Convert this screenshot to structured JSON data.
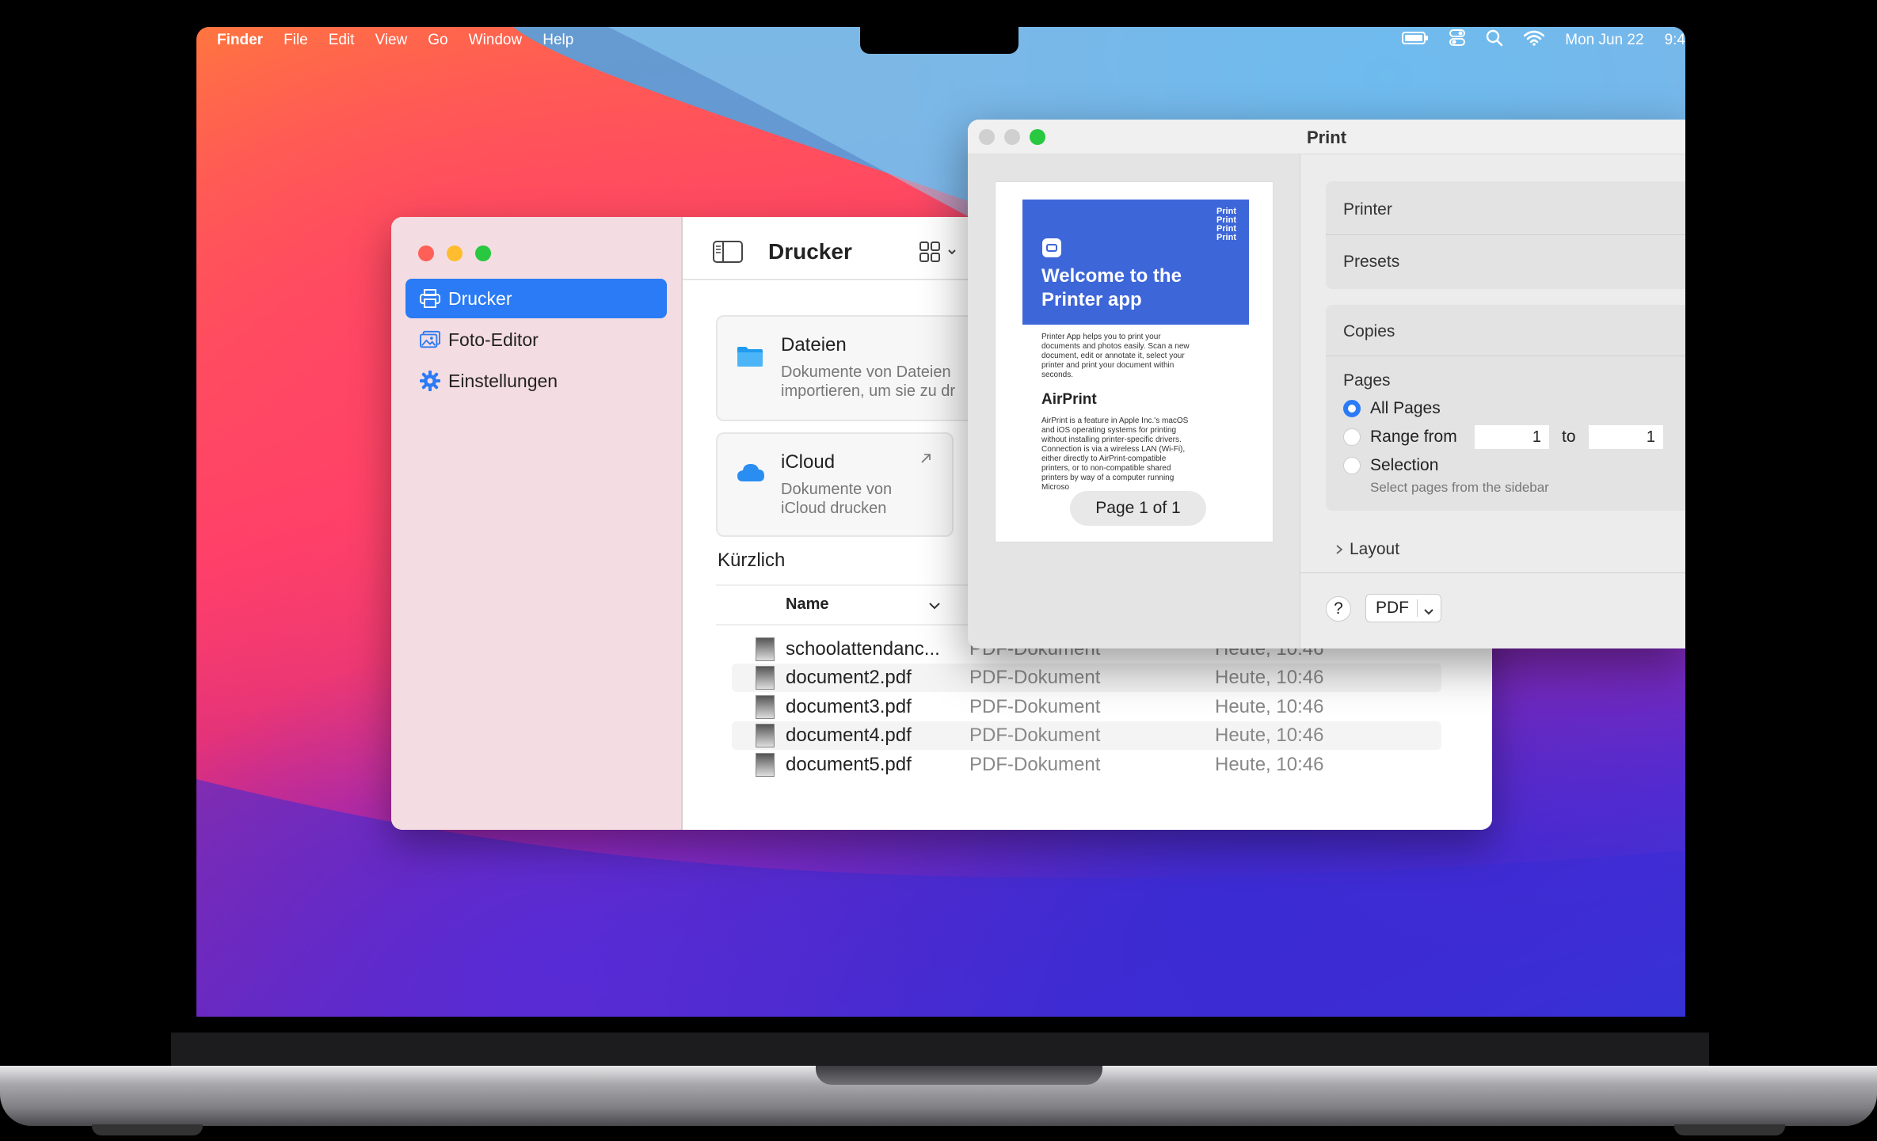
{
  "menubar": {
    "app": "Finder",
    "items": [
      "File",
      "Edit",
      "View",
      "Go",
      "Window",
      "Help"
    ],
    "clock": "Mon Jun 22",
    "time": "9:4"
  },
  "sidebar": {
    "items": [
      {
        "label": "Drucker"
      },
      {
        "label": "Foto-Editor"
      },
      {
        "label": "Einstellungen"
      }
    ]
  },
  "main": {
    "title": "Drucker",
    "cards": [
      {
        "title": "Dateien",
        "subtitle1": "Dokumente von Dateien",
        "subtitle2": "importieren, um sie zu dr"
      },
      {
        "title": "iCloud",
        "subtitle1": "Dokumente von",
        "subtitle2": "iCloud drucken"
      }
    ],
    "recent_title": "Kürzlich",
    "column_name": "Name",
    "files": [
      {
        "name": "schoolattendanc...",
        "kind": "PDF-Dokument",
        "date": "Heute, 10:46"
      },
      {
        "name": "document2.pdf",
        "kind": "PDF-Dokument",
        "date": "Heute, 10:46"
      },
      {
        "name": "document3.pdf",
        "kind": "PDF-Dokument",
        "date": "Heute, 10:46"
      },
      {
        "name": "document4.pdf",
        "kind": "PDF-Dokument",
        "date": "Heute, 10:46"
      },
      {
        "name": "document5.pdf",
        "kind": "PDF-Dokument",
        "date": "Heute, 10:46"
      }
    ]
  },
  "print": {
    "title": "Print",
    "preview": {
      "banner_title_1": "Welcome to the",
      "banner_title_2": "Printer app",
      "banner_print": [
        "Print",
        "Print",
        "Print",
        "Print"
      ],
      "intro_lines": [
        "Printer App helps you to print your",
        "documents and photos easily. Scan a new",
        "document, edit or annotate it, select your",
        "printer and print your document within",
        "seconds."
      ],
      "heading": "AirPrint",
      "body_lines": [
        "AirPrint is a feature in Apple Inc.'s macOS",
        "and iOS operating systems for printing",
        "without installing printer-specific drivers.",
        "Connection is via a wireless LAN (Wi-Fi),",
        "either directly to AirPrint-compatible",
        "printers, or to non-compatible shared",
        "printers by way of a computer running",
        "Microso"
      ],
      "page_label": "Page 1 of 1"
    },
    "printer_label": "Printer",
    "presets_label": "Presets",
    "copies_label": "Copies",
    "pages_label": "Pages",
    "all_pages": "All Pages",
    "range_from": "Range from",
    "range_start": "1",
    "range_to": "to",
    "range_end": "1",
    "selection": "Selection",
    "selection_hint": "Select pages from the sidebar",
    "layout_label": "Layout",
    "help_label": "?",
    "pdf_label": "PDF"
  }
}
